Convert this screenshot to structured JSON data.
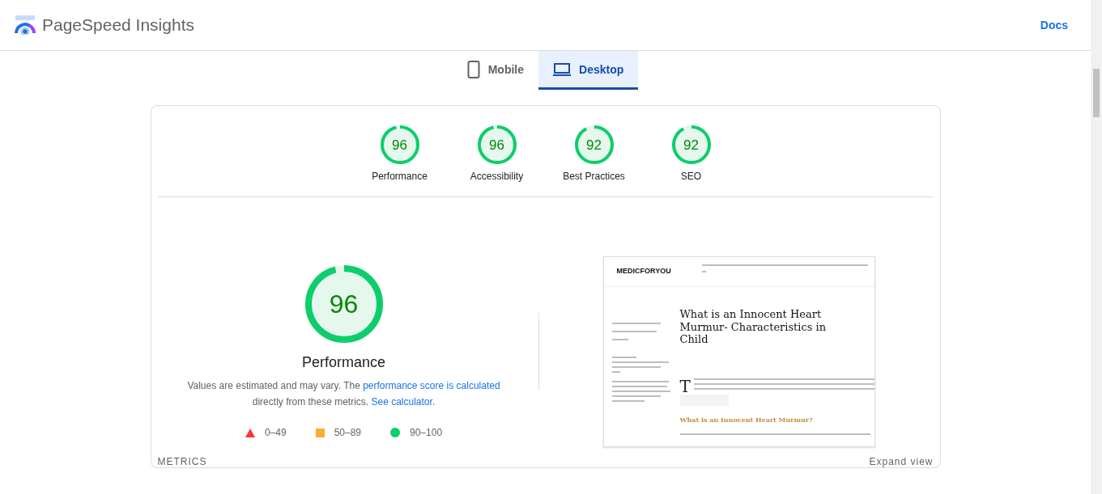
{
  "header": {
    "title": "PageSpeed Insights",
    "docs_link": "Docs"
  },
  "tabs": [
    {
      "label": "Mobile",
      "kind": "phone",
      "selected": false
    },
    {
      "label": "Desktop",
      "kind": "laptop",
      "selected": true
    }
  ],
  "categories": [
    {
      "score": "96",
      "label": "Performance"
    },
    {
      "score": "96",
      "label": "Accessibility"
    },
    {
      "score": "92",
      "label": "Best Practices"
    },
    {
      "score": "92",
      "label": "SEO"
    }
  ],
  "performance": {
    "score": "96",
    "title": "Performance",
    "description": {
      "text_1": "Values are estimated and may vary. The ",
      "link_1": "performance score is calculated",
      "text_2": " directly from these metrics. ",
      "link_2": "See calculator",
      "text_3": "."
    },
    "legend": [
      {
        "kind": "triangle",
        "range": "0–49"
      },
      {
        "kind": "square",
        "range": "50–89"
      },
      {
        "kind": "circle",
        "range": "90–100"
      }
    ]
  },
  "screenshot": {
    "logo": "MEDICFORYOU",
    "title": "What is an Innocent Heart Murmur- Characteristics in Child",
    "drop_cap": "T",
    "heading": "What is an Innocent Heart Murmur?"
  },
  "metrics": {
    "heading": "METRICS",
    "expand": "Expand view"
  }
}
